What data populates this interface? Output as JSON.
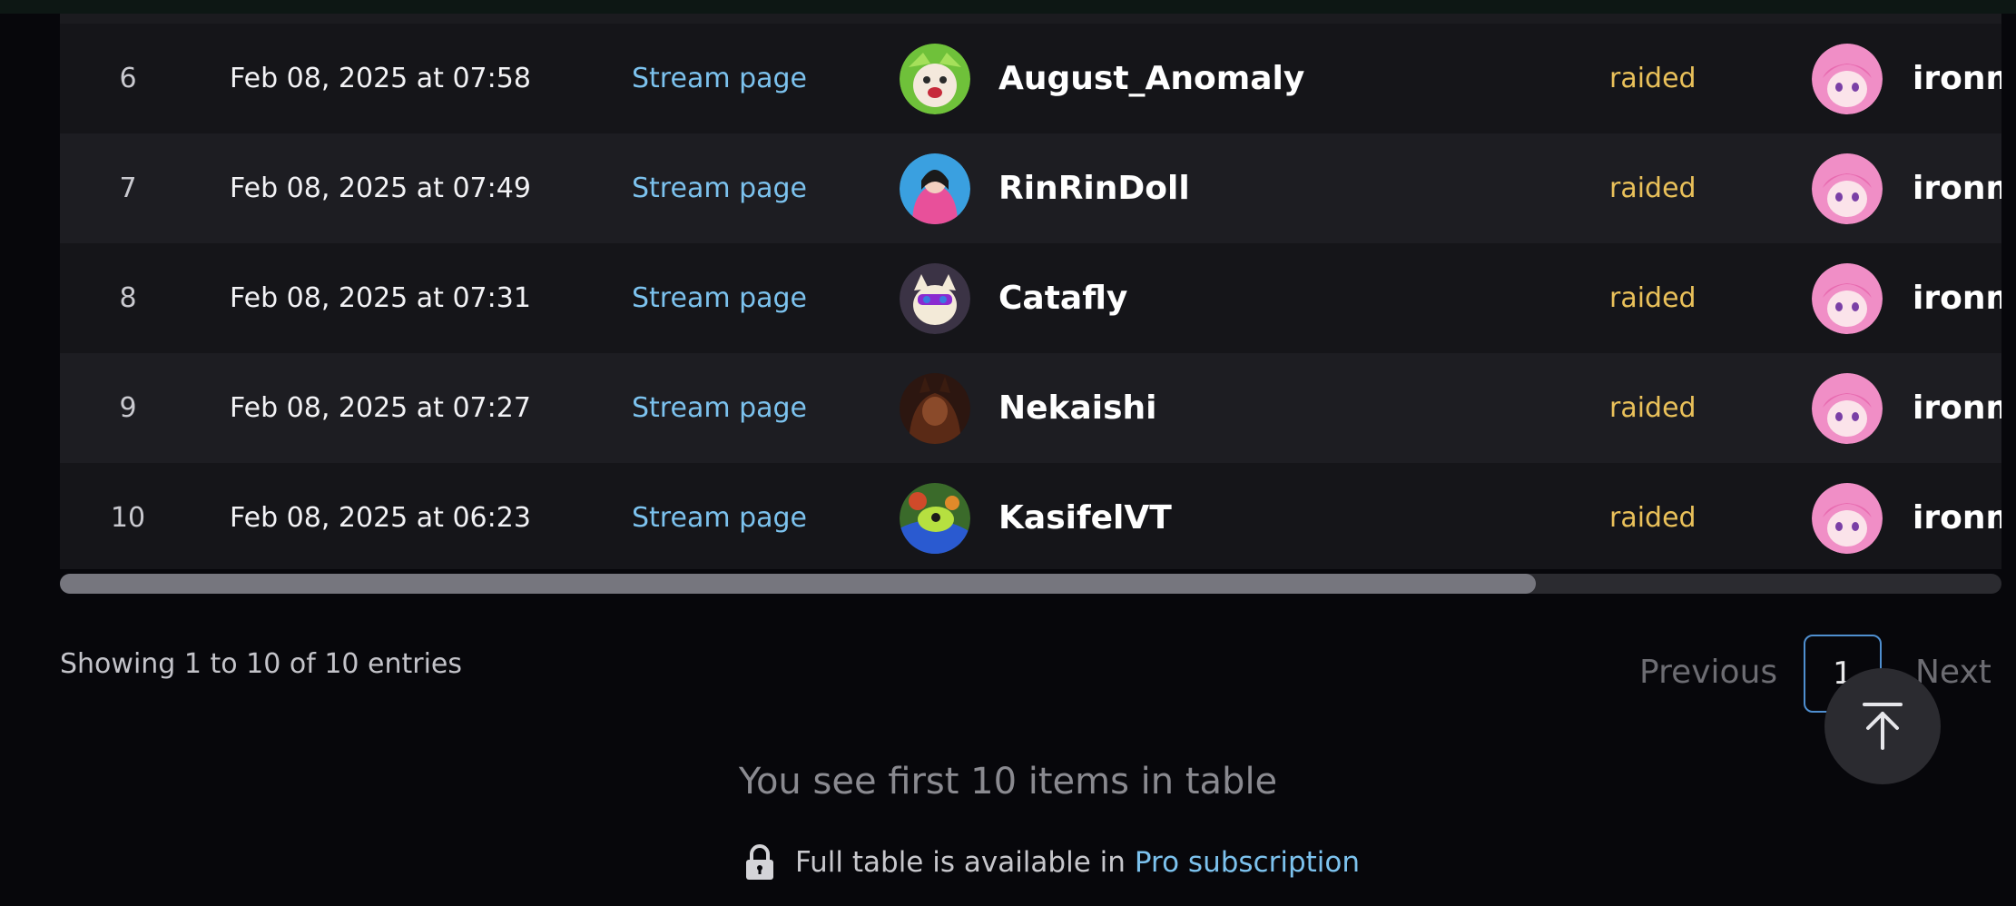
{
  "table": {
    "rows": [
      {
        "num": "6",
        "date": "Feb 08, 2025 at 07:58",
        "link": "Stream page",
        "raider": "August_Anomaly",
        "status": "raided",
        "target": "ironm",
        "avatar_color": "#7fcf3f"
      },
      {
        "num": "7",
        "date": "Feb 08, 2025 at 07:49",
        "link": "Stream page",
        "raider": "RinRinDoll",
        "status": "raided",
        "target": "ironm",
        "avatar_color": "#3aa0e0"
      },
      {
        "num": "8",
        "date": "Feb 08, 2025 at 07:31",
        "link": "Stream page",
        "raider": "Catafly",
        "status": "raided",
        "target": "ironm",
        "avatar_color": "#3b3345"
      },
      {
        "num": "9",
        "date": "Feb 08, 2025 at 07:27",
        "link": "Stream page",
        "raider": "Nekaishi",
        "status": "raided",
        "target": "ironm",
        "avatar_color": "#4a2418"
      },
      {
        "num": "10",
        "date": "Feb 08, 2025 at 06:23",
        "link": "Stream page",
        "raider": "KasifelVT",
        "status": "raided",
        "target": "ironm",
        "avatar_color": "#3a7a2a"
      }
    ]
  },
  "pagination": {
    "showing": "Showing 1 to 10 of 10 entries",
    "previous": "Previous",
    "current": "1",
    "next": "Next"
  },
  "footer": {
    "first_items": "You see first 10 items in table",
    "pro_text": "Full table is available in",
    "pro_link": "Pro subscription"
  },
  "colors": {
    "link": "#7cc2ee",
    "status": "#eac15a",
    "background": "#07070b"
  }
}
